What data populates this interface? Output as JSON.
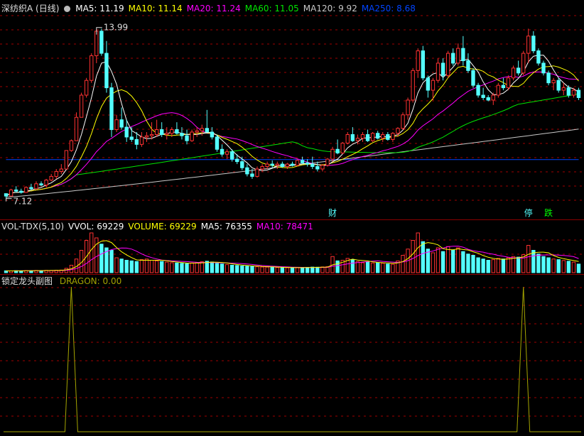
{
  "colors": {
    "up": "#ff3232",
    "down": "#54ffff",
    "grid": "#a00000",
    "ma5": "#ffffff",
    "ma10": "#ffff00",
    "ma20": "#ff00ff",
    "ma60": "#00e600",
    "ma120": "#c8c8c8",
    "ma250": "#0044ff",
    "dragon": "#a4a400"
  },
  "price_panel": {
    "title": "深纺织A (日线)",
    "menu_icon": "circle-icon",
    "legend": [
      {
        "key": "ma5",
        "text": "MA5: 11.19"
      },
      {
        "key": "ma10",
        "text": "MA10: 11.14"
      },
      {
        "key": "ma20",
        "text": "MA20: 11.24"
      },
      {
        "key": "ma60",
        "text": "MA60: 11.05"
      },
      {
        "key": "ma120",
        "text": "MA120: 9.92"
      },
      {
        "key": "ma250",
        "text": "MA250: 8.68"
      }
    ],
    "high_label": "13.99",
    "low_label": "7.12",
    "markers": [
      {
        "text": "财",
        "color": "#54ffff"
      },
      {
        "text": "停",
        "color": "#54ffff"
      },
      {
        "text": "跌",
        "color": "#00ff00"
      }
    ]
  },
  "volume_panel": {
    "title": "VOL-TDX(5,10)",
    "menu_icon": "circle-icon",
    "legend": [
      {
        "key": "vol_white",
        "text": "VVOL: 69229"
      },
      {
        "key": "vol_yellow",
        "text": "VOLUME: 69229"
      },
      {
        "key": "ma5",
        "text": "MA5: 76355"
      },
      {
        "key": "ma20",
        "text": "MA10: 78471"
      }
    ]
  },
  "dragon_panel": {
    "title": "锁定龙头副图",
    "legend": [
      {
        "key": "dragon",
        "text": "DRAGON: 0.00"
      }
    ]
  },
  "chart_data": [
    {
      "type": "candlestick",
      "title": "深纺织A (日线)",
      "price_range": [
        7.12,
        13.99
      ],
      "bars": [
        [
          7.3,
          7.3,
          7.1,
          7.2
        ],
        [
          7.2,
          7.5,
          7.2,
          7.45
        ],
        [
          7.45,
          7.6,
          7.35,
          7.4
        ],
        [
          7.4,
          7.5,
          7.3,
          7.35
        ],
        [
          7.35,
          7.6,
          7.35,
          7.55
        ],
        [
          7.55,
          7.7,
          7.45,
          7.5
        ],
        [
          7.5,
          7.8,
          7.5,
          7.7
        ],
        [
          7.7,
          7.8,
          7.6,
          7.65
        ],
        [
          7.65,
          7.9,
          7.55,
          7.85
        ],
        [
          7.85,
          8.1,
          7.8,
          8
        ],
        [
          8,
          8.3,
          7.9,
          8.2
        ],
        [
          8.2,
          8.5,
          8.1,
          8.3
        ],
        [
          8.3,
          9.05,
          8.3,
          9.05
        ],
        [
          9.05,
          9.5,
          9,
          9.45
        ],
        [
          9.45,
          10.6,
          9.45,
          10.4
        ],
        [
          10.4,
          11.4,
          10.4,
          11.3
        ],
        [
          11.3,
          12,
          11.2,
          11.9
        ],
        [
          11.9,
          13,
          11.8,
          12.9
        ],
        [
          12.9,
          13.99,
          12.6,
          13.9
        ],
        [
          13.9,
          14,
          12.9,
          13
        ],
        [
          13,
          13.5,
          11.4,
          11.6
        ],
        [
          11.6,
          11.8,
          9.6,
          9.9
        ],
        [
          9.9,
          10.5,
          9.8,
          10.3
        ],
        [
          10.3,
          10.8,
          9.9,
          10
        ],
        [
          10,
          10.3,
          9.4,
          9.6
        ],
        [
          9.6,
          10,
          9.4,
          9.5
        ],
        [
          9.5,
          9.8,
          9.1,
          9.3
        ],
        [
          9.3,
          9.8,
          9.2,
          9.6
        ],
        [
          9.6,
          9.8,
          9.4,
          9.65
        ],
        [
          9.65,
          10.2,
          9.5,
          9.7
        ],
        [
          9.7,
          10.3,
          9.6,
          9.9
        ],
        [
          9.9,
          10.2,
          9.6,
          9.7
        ],
        [
          9.7,
          10,
          9.5,
          9.75
        ],
        [
          9.75,
          10,
          9.6,
          9.9
        ],
        [
          9.9,
          10.2,
          9.7,
          9.75
        ],
        [
          9.75,
          10,
          9.5,
          9.65
        ],
        [
          9.65,
          9.9,
          9.3,
          9.45
        ],
        [
          9.45,
          9.9,
          9.4,
          9.8
        ],
        [
          9.8,
          10,
          9.6,
          9.85
        ],
        [
          9.85,
          10.1,
          9.65,
          9.95
        ],
        [
          9.95,
          10.7,
          9.9,
          9.8
        ],
        [
          9.8,
          10,
          9.5,
          9.6
        ],
        [
          9.6,
          9.7,
          9,
          9.1
        ],
        [
          9.1,
          9.3,
          8.8,
          8.9
        ],
        [
          8.9,
          9.1,
          8.7,
          9
        ],
        [
          9,
          9.1,
          8.6,
          8.7
        ],
        [
          8.7,
          8.9,
          8.5,
          8.6
        ],
        [
          8.6,
          8.8,
          8.25,
          8.35
        ],
        [
          8.35,
          8.5,
          8,
          8.1
        ],
        [
          8.1,
          8.3,
          7.9,
          8
        ],
        [
          8,
          8.4,
          7.95,
          8.3
        ],
        [
          8.3,
          8.5,
          8.2,
          8.4
        ],
        [
          8.4,
          8.6,
          8.3,
          8.5
        ],
        [
          8.5,
          8.65,
          8.35,
          8.45
        ],
        [
          8.45,
          8.6,
          8.3,
          8.5
        ],
        [
          8.5,
          8.6,
          8.35,
          8.4
        ],
        [
          8.4,
          8.55,
          8.3,
          8.5
        ],
        [
          8.5,
          8.6,
          8.4,
          8.45
        ],
        [
          8.45,
          8.7,
          8.4,
          8.65
        ],
        [
          8.65,
          8.8,
          8.5,
          8.55
        ],
        [
          8.55,
          8.7,
          8.4,
          8.5
        ],
        [
          8.5,
          8.8,
          8.3,
          8.4
        ],
        [
          8.4,
          8.6,
          8.2,
          8.3
        ],
        [
          8.3,
          8.5,
          8.2,
          8.45
        ],
        [
          8.45,
          8.75,
          8.4,
          8.7
        ],
        [
          8.7,
          9.2,
          8.6,
          9.1
        ],
        [
          9.1,
          9.5,
          8.9,
          8.95
        ],
        [
          8.95,
          9.4,
          8.9,
          9.35
        ],
        [
          9.35,
          9.8,
          9.3,
          9.7
        ],
        [
          9.7,
          10,
          9.4,
          9.45
        ],
        [
          9.45,
          9.7,
          9.3,
          9.55
        ],
        [
          9.55,
          9.8,
          9.4,
          9.7
        ],
        [
          9.7,
          9.9,
          9.4,
          9.45
        ],
        [
          9.45,
          9.8,
          9.4,
          9.75
        ],
        [
          9.75,
          9.85,
          9.5,
          9.55
        ],
        [
          9.55,
          9.8,
          9.4,
          9.7
        ],
        [
          9.7,
          9.8,
          9.45,
          9.5
        ],
        [
          9.5,
          9.8,
          9.4,
          9.75
        ],
        [
          9.75,
          10,
          9.6,
          9.95
        ],
        [
          9.95,
          10.6,
          9.9,
          10.5
        ],
        [
          10.5,
          11.2,
          10.3,
          11.1
        ],
        [
          11.1,
          12.4,
          11,
          12.3
        ],
        [
          12.3,
          13.2,
          12,
          13.1
        ],
        [
          13.1,
          13.3,
          11.9,
          12
        ],
        [
          12,
          12.1,
          11.2,
          11.5
        ],
        [
          11.5,
          12,
          11.1,
          11.9
        ],
        [
          11.9,
          12.8,
          11.8,
          12.6
        ],
        [
          12.6,
          12.8,
          11.9,
          12.1
        ],
        [
          12.1,
          13.1,
          12,
          13
        ],
        [
          13,
          13.2,
          12.5,
          12.6
        ],
        [
          12.6,
          13.4,
          12.5,
          13.2
        ],
        [
          13.2,
          13.7,
          12.5,
          12.7
        ],
        [
          12.7,
          13,
          12.2,
          12.3
        ],
        [
          12.3,
          12.4,
          11.6,
          11.7
        ],
        [
          11.7,
          11.8,
          11.2,
          11.3
        ],
        [
          11.3,
          11.6,
          11.1,
          11.2
        ],
        [
          11.2,
          11.3,
          11.05,
          11.1
        ],
        [
          11.1,
          11.4,
          10.9,
          11.3
        ],
        [
          11.3,
          11.8,
          11.2,
          11.7
        ],
        [
          11.7,
          12,
          11.5,
          11.6
        ],
        [
          11.6,
          12.1,
          11.5,
          12
        ],
        [
          12,
          12.5,
          11.9,
          12.4
        ],
        [
          12.4,
          12.7,
          12.1,
          12.2
        ],
        [
          12.2,
          13.1,
          12.1,
          13
        ],
        [
          13,
          14,
          12.6,
          13.7
        ],
        [
          13.7,
          13.9,
          13,
          13.1
        ],
        [
          13.1,
          13.2,
          12.5,
          12.6
        ],
        [
          12.6,
          12.7,
          12.1,
          12.2
        ],
        [
          12.2,
          12.3,
          11.7,
          11.8
        ],
        [
          11.8,
          12,
          11.5,
          11.9
        ],
        [
          11.9,
          12,
          11.4,
          11.5
        ],
        [
          11.5,
          11.8,
          11.3,
          11.6
        ],
        [
          11.6,
          11.7,
          11.2,
          11.3
        ],
        [
          11.3,
          11.6,
          11.2,
          11.5
        ],
        [
          11.5,
          11.6,
          11.1,
          11.2
        ]
      ],
      "series": [
        {
          "name": "MA5",
          "key": "ma5",
          "last": 11.19
        },
        {
          "name": "MA10",
          "key": "ma10",
          "last": 11.14
        },
        {
          "name": "MA20",
          "key": "ma20",
          "last": 11.24
        },
        {
          "name": "MA60",
          "key": "ma60",
          "last": 11.05
        },
        {
          "name": "MA120",
          "key": "ma120",
          "last": 9.92
        },
        {
          "name": "MA250",
          "key": "ma250",
          "last": 8.68
        }
      ],
      "markers": [
        {
          "bar": 65,
          "text": "财"
        },
        {
          "bar": 104,
          "text": "停"
        },
        {
          "bar": 108,
          "text": "跌"
        }
      ]
    },
    {
      "type": "bar",
      "title": "VOL-TDX(5,10)",
      "values": [
        15000,
        14000,
        16000,
        15000,
        17000,
        16000,
        18000,
        17000,
        19000,
        18000,
        20000,
        21000,
        35000,
        60000,
        110000,
        180000,
        260000,
        320000,
        280000,
        230000,
        200000,
        180000,
        120000,
        110000,
        100000,
        95000,
        90000,
        105000,
        110000,
        100000,
        95000,
        90000,
        85000,
        80000,
        78000,
        75000,
        72000,
        78000,
        82000,
        88000,
        92000,
        86000,
        75000,
        70000,
        65000,
        60000,
        58000,
        54000,
        52000,
        50000,
        48000,
        46000,
        45000,
        44000,
        42000,
        40000,
        40000,
        39000,
        41000,
        42000,
        43000,
        45000,
        44000,
        46000,
        48000,
        130000,
        95000,
        100000,
        115000,
        105000,
        90000,
        80000,
        85000,
        78000,
        82000,
        76000,
        70000,
        68000,
        95000,
        140000,
        190000,
        260000,
        320000,
        250000,
        190000,
        160000,
        200000,
        170000,
        210000,
        180000,
        200000,
        170000,
        150000,
        140000,
        120000,
        110000,
        100000,
        105000,
        115000,
        110000,
        120000,
        130000,
        125000,
        145000,
        220000,
        180000,
        150000,
        130000,
        120000,
        110000,
        105000,
        98000,
        92000,
        85000,
        69229
      ],
      "series": [
        {
          "name": "MA5",
          "key": "ma5",
          "last": 76355
        },
        {
          "name": "MA10",
          "key": "ma20",
          "last": 78471
        }
      ]
    },
    {
      "type": "line",
      "title": "锁定龙头副图",
      "series": [
        {
          "name": "DRAGON",
          "last": 0.0,
          "spikes_at_bar": [
            13,
            103
          ]
        }
      ]
    }
  ]
}
